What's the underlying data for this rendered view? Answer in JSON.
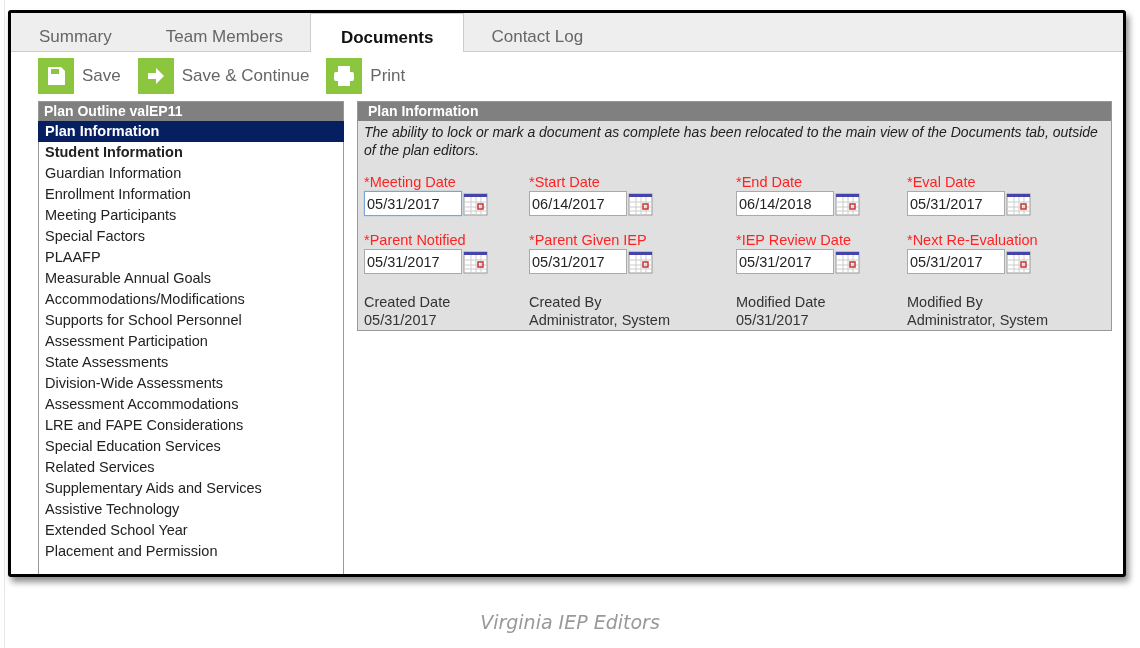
{
  "tabs": [
    {
      "label": "Summary",
      "selected": false
    },
    {
      "label": "Team Members",
      "selected": false
    },
    {
      "label": "Documents",
      "selected": true
    },
    {
      "label": "Contact Log",
      "selected": false
    }
  ],
  "toolbar": [
    {
      "kind": "save",
      "label": "Save"
    },
    {
      "kind": "continue",
      "label": "Save & Continue"
    },
    {
      "kind": "print",
      "label": "Print"
    }
  ],
  "outline": {
    "title": "Plan Outline valEP11",
    "items": [
      {
        "label": "Plan Information",
        "selected": true,
        "bold": true
      },
      {
        "label": "Student Information",
        "selected": false,
        "bold": true
      },
      {
        "label": "Guardian Information",
        "selected": false,
        "bold": false
      },
      {
        "label": "Enrollment Information",
        "selected": false,
        "bold": false
      },
      {
        "label": "Meeting Participants",
        "selected": false,
        "bold": false
      },
      {
        "label": "Special Factors",
        "selected": false,
        "bold": false
      },
      {
        "label": "PLAAFP",
        "selected": false,
        "bold": false
      },
      {
        "label": "Measurable Annual Goals",
        "selected": false,
        "bold": false
      },
      {
        "label": "Accommodations/Modifications",
        "selected": false,
        "bold": false
      },
      {
        "label": "Supports for School Personnel",
        "selected": false,
        "bold": false
      },
      {
        "label": "Assessment Participation",
        "selected": false,
        "bold": false
      },
      {
        "label": "State Assessments",
        "selected": false,
        "bold": false
      },
      {
        "label": "Division-Wide Assessments",
        "selected": false,
        "bold": false
      },
      {
        "label": "Assessment Accommodations",
        "selected": false,
        "bold": false
      },
      {
        "label": "LRE and FAPE Considerations",
        "selected": false,
        "bold": false
      },
      {
        "label": "Special Education Services",
        "selected": false,
        "bold": false
      },
      {
        "label": "Related Services",
        "selected": false,
        "bold": false
      },
      {
        "label": "Supplementary Aids and Services",
        "selected": false,
        "bold": false
      },
      {
        "label": "Assistive Technology",
        "selected": false,
        "bold": false
      },
      {
        "label": "Extended School Year",
        "selected": false,
        "bold": false
      },
      {
        "label": "Placement and Permission",
        "selected": false,
        "bold": false
      }
    ]
  },
  "plan": {
    "title": "Plan Information",
    "notice": "The ability to lock or mark a document as complete has been relocated to the main view of the Documents tab, outside of the plan editors.",
    "fields": [
      {
        "label": "*Meeting Date",
        "value": "05/31/2017",
        "focused": true
      },
      {
        "label": "*Start Date",
        "value": "06/14/2017",
        "focused": false
      },
      {
        "label": "*End Date",
        "value": "06/14/2018",
        "focused": false
      },
      {
        "label": "*Eval Date",
        "value": "05/31/2017",
        "focused": false
      },
      {
        "label": "*Parent Notified",
        "value": "05/31/2017",
        "focused": false
      },
      {
        "label": "*Parent Given IEP",
        "value": "05/31/2017",
        "focused": false
      },
      {
        "label": "*IEP Review Date",
        "value": "05/31/2017",
        "focused": false
      },
      {
        "label": "*Next Re-Evaluation",
        "value": "05/31/2017",
        "focused": false
      }
    ],
    "info": [
      {
        "label": "Created Date",
        "value": "05/31/2017"
      },
      {
        "label": "Created By",
        "value": "Administrator, System"
      },
      {
        "label": "Modified Date",
        "value": "05/31/2017"
      },
      {
        "label": "Modified By",
        "value": "Administrator, System"
      }
    ]
  },
  "caption": "Virginia IEP Editors"
}
